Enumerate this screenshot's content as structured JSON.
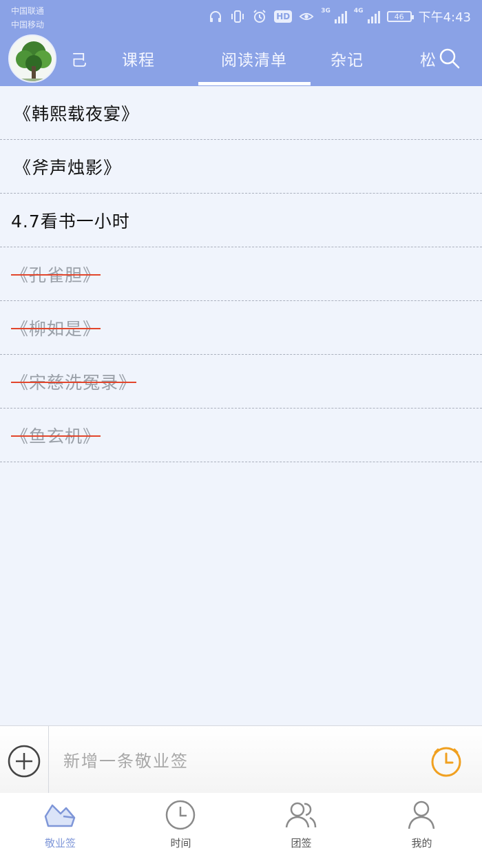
{
  "status_bar": {
    "carrier_1": "中国联通",
    "carrier_2": "中国移动",
    "net_1": "3G",
    "net_2": "4G",
    "battery": "46",
    "time": "下午4:43"
  },
  "tabs": [
    {
      "label": "己",
      "active": false
    },
    {
      "label": "课程",
      "active": false
    },
    {
      "label": "阅读清单",
      "active": true
    },
    {
      "label": "杂记",
      "active": false
    },
    {
      "label": "松",
      "active": false
    }
  ],
  "list": [
    {
      "text": "《韩熙载夜宴》",
      "done": false
    },
    {
      "text": "《斧声烛影》",
      "done": false
    },
    {
      "text": "4.7看书一小时",
      "done": false
    },
    {
      "text": "《孔雀胆》",
      "done": true
    },
    {
      "text": "《柳如是》",
      "done": true
    },
    {
      "text": "《宋慈洗冤录》",
      "done": true
    },
    {
      "text": "《鱼玄机》",
      "done": true
    }
  ],
  "input": {
    "placeholder": "新增一条敬业签"
  },
  "bottom_nav": [
    {
      "label": "敬业签",
      "icon": "memo-icon",
      "active": true
    },
    {
      "label": "时间",
      "icon": "clock-icon",
      "active": false
    },
    {
      "label": "团签",
      "icon": "group-icon",
      "active": false
    },
    {
      "label": "我的",
      "icon": "profile-icon",
      "active": false
    }
  ],
  "colors": {
    "header": "#8aa2e6",
    "list_bg": "#f0f4fc",
    "strike": "#e2452b",
    "timer": "#f0a020",
    "nav_active": "#7e96d8"
  }
}
